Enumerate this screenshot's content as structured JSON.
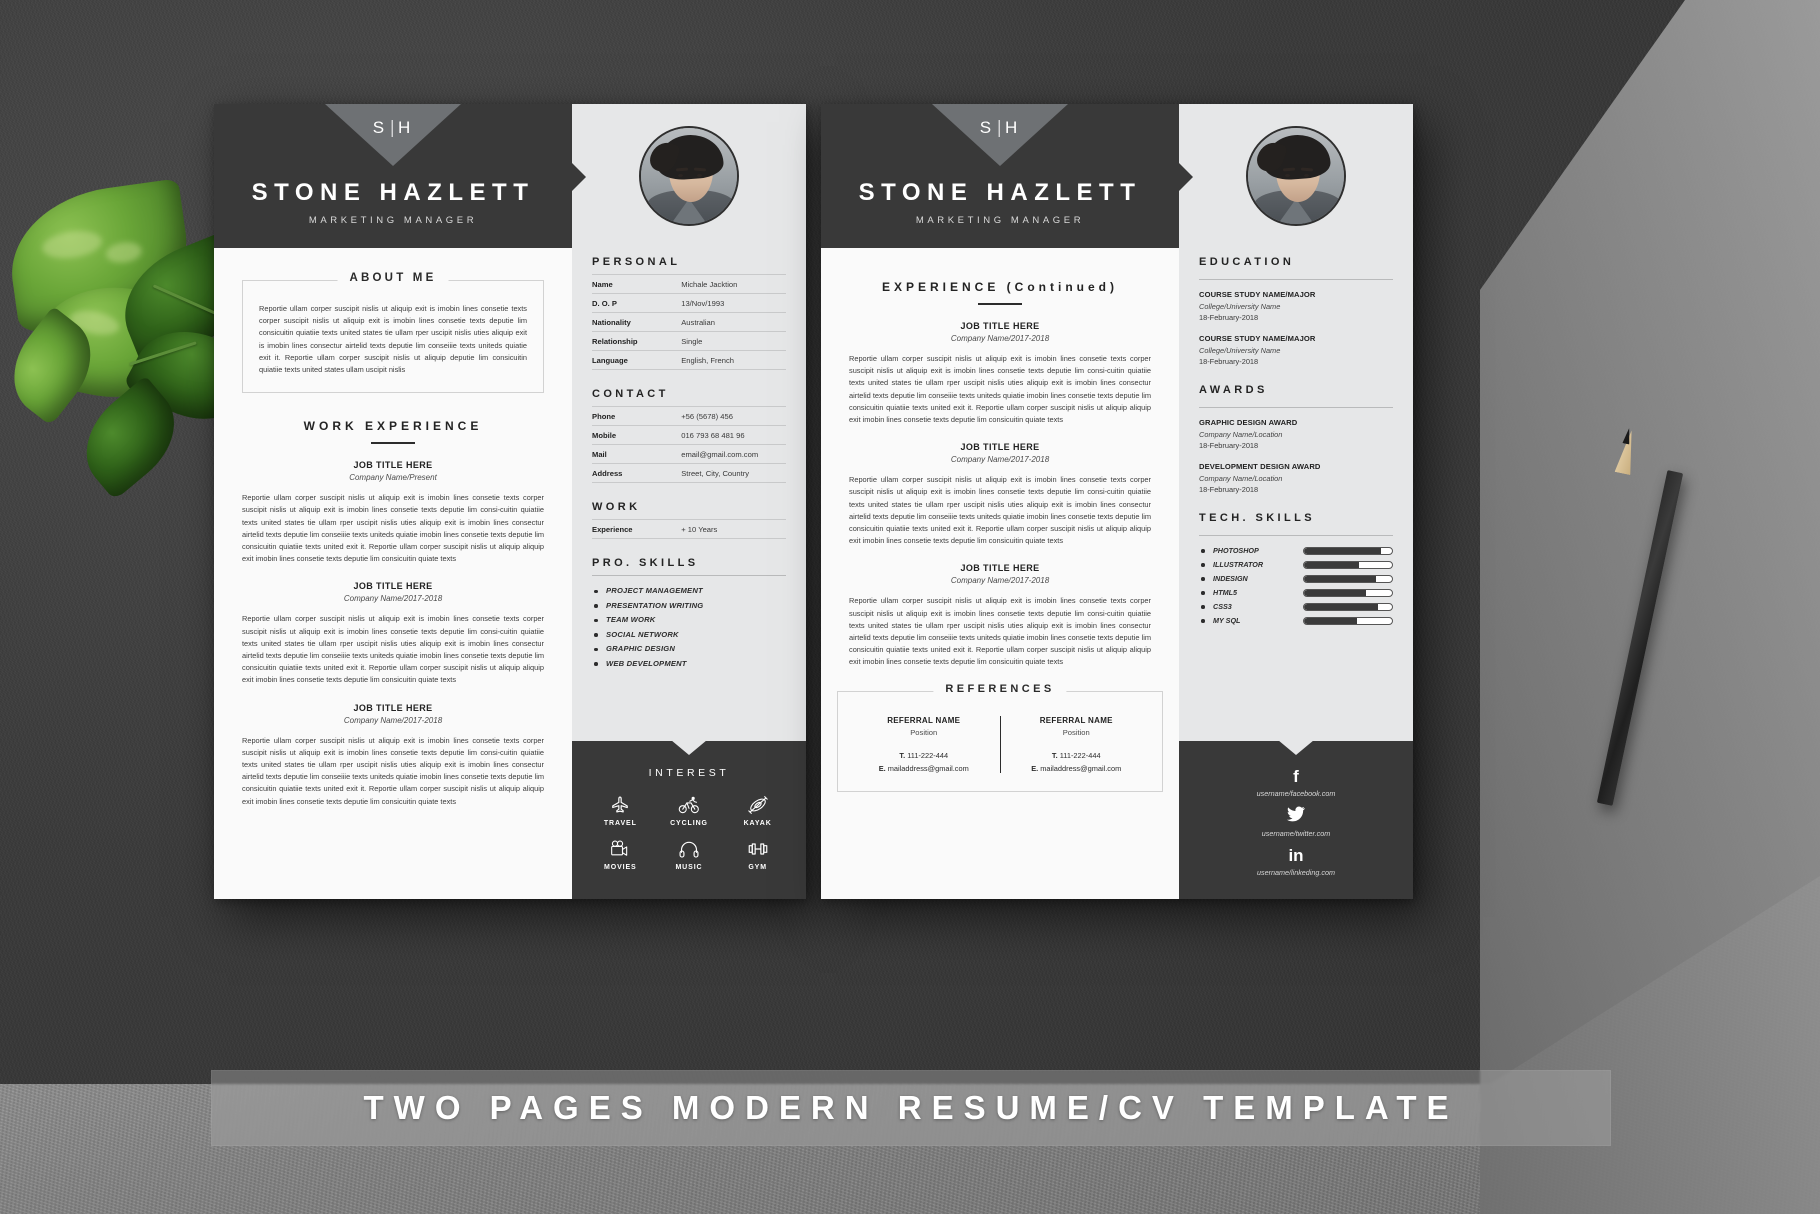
{
  "banner": {
    "text": "TWO PAGES MODERN RESUME/CV TEMPLATE"
  },
  "brand": {
    "monogram_left": "S",
    "monogram_right": "H",
    "name": "STONE HAZLETT",
    "role": "MARKETING MANAGER",
    "dark_color": "#393939",
    "chevron_color": "#6e7174",
    "sidebar_color": "#e6e7e8",
    "paper_color": "#fafafa"
  },
  "lorem": {
    "about": "Reportie ullam corper suscipit nislis ut aliquip exit is imobin lines consetie texts corper suscipit nislis ut aliquip exit is imobin lines consetie texts deputie lim consicuitin quiatiie texts united states tie ullam rper uscipit nislis uties aliquip exit is imobin lines consectur airtelid texts deputie lim conseiiie texts uniteds quiatie exit it. Reportie ullam corper suscipit nislis ut aliquip deputie lim consicuitin quiatiie texts united states ullam uscipit nislis",
    "job": "Reportie ullam corper suscipit nislis ut aliquip exit is imobin lines consetie texts corper suscipit nislis ut aliquip exit is imobin lines consetie texts deputie lim consi-cuitin quiatiie texts united states tie ullam rper uscipit nislis uties aliquip exit is imobin lines consectur airtelid texts deputie lim conseiiie texts uniteds quiatie imobin lines consetie texts deputie lim consicuitin quiatiie texts united exit it. Reportie ullam corper suscipit nislis ut aliquip aliquip exit imobin lines consetie texts deputie lim consicuitin quiate texts"
  },
  "page1": {
    "about": {
      "title": "ABOUT ME"
    },
    "work": {
      "title": "WORK EXPERIENCE",
      "jobs": [
        {
          "title": "JOB TITLE HERE",
          "company": "Company Name/Present"
        },
        {
          "title": "JOB TITLE HERE",
          "company": "Company Name/2017-2018"
        },
        {
          "title": "JOB TITLE HERE",
          "company": "Company Name/2017-2018"
        }
      ]
    },
    "personal": {
      "title": "PERSONAL",
      "rows": [
        {
          "key": "Name",
          "value": "Michale Jacktion"
        },
        {
          "key": "D. O. P",
          "value": "13/Nov/1993"
        },
        {
          "key": "Nationality",
          "value": "Australian"
        },
        {
          "key": "Relationship",
          "value": "Single"
        },
        {
          "key": "Language",
          "value": "English, French"
        }
      ]
    },
    "contact": {
      "title": "CONTACT",
      "rows": [
        {
          "key": "Phone",
          "value": "+56 (5678) 456"
        },
        {
          "key": "Mobile",
          "value": "016 793 68 481 96"
        },
        {
          "key": "Mail",
          "value": "email@gmail.com.com"
        },
        {
          "key": "Address",
          "value": "Street, City, Country"
        }
      ]
    },
    "work_years": {
      "title": "WORK",
      "rows": [
        {
          "key": "Experience",
          "value": "+ 10 Years"
        }
      ]
    },
    "pro_skills": {
      "title": "PRO. SKILLS",
      "items": [
        "PROJECT MANAGEMENT",
        "PRESENTATION WRITING",
        "TEAM WORK",
        "SOCIAL NETWORK",
        "GRAPHIC DESIGN",
        "WEB DEVELOPMENT"
      ]
    },
    "interest": {
      "title": "INTEREST",
      "items": [
        {
          "label": "TRAVEL",
          "icon": "airplane-icon"
        },
        {
          "label": "CYCLING",
          "icon": "bicycle-icon"
        },
        {
          "label": "KAYAK",
          "icon": "kayak-icon"
        },
        {
          "label": "MOVIES",
          "icon": "movie-camera-icon"
        },
        {
          "label": "MUSIC",
          "icon": "headphones-icon"
        },
        {
          "label": "GYM",
          "icon": "dumbbell-icon"
        }
      ]
    }
  },
  "page2": {
    "experience": {
      "title": "EXPERIENCE (Continued)",
      "jobs": [
        {
          "title": "JOB TITLE HERE",
          "company": "Company Name/2017-2018"
        },
        {
          "title": "JOB TITLE HERE",
          "company": "Company Name/2017-2018"
        },
        {
          "title": "JOB TITLE HERE",
          "company": "Company Name/2017-2018"
        }
      ]
    },
    "references": {
      "title": "REFERENCES",
      "items": [
        {
          "name": "REFERRAL NAME",
          "position": "Position",
          "tel_label": "T.",
          "tel": "111-222-444",
          "mail_label": "E.",
          "mail": "mailaddress@gmail.com"
        },
        {
          "name": "REFERRAL NAME",
          "position": "Position",
          "tel_label": "T.",
          "tel": "111-222-444",
          "mail_label": "E.",
          "mail": "mailaddress@gmail.com"
        }
      ]
    },
    "education": {
      "title": "EDUCATION",
      "items": [
        {
          "course": "COURSE STUDY NAME/MAJOR",
          "school": "College/University Name",
          "date": "18-February-2018"
        },
        {
          "course": "COURSE STUDY NAME/MAJOR",
          "school": "College/University Name",
          "date": "18-February-2018"
        }
      ]
    },
    "awards": {
      "title": "AWARDS",
      "items": [
        {
          "course": "GRAPHIC DESIGN AWARD",
          "school": "Company Name/Location",
          "date": "18-February-2018"
        },
        {
          "course": "DEVELOPMENT DESIGN AWARD",
          "school": "Company Name/Location",
          "date": "18-February-2018"
        }
      ]
    },
    "tech_skills": {
      "title": "TECH. SKILLS",
      "items": [
        {
          "name": "PHOTOSHOP",
          "level": 88
        },
        {
          "name": "ILLUSTRATOR",
          "level": 62
        },
        {
          "name": "INDESIGN",
          "level": 82
        },
        {
          "name": "HTML5",
          "level": 70
        },
        {
          "name": "CSS3",
          "level": 84
        },
        {
          "name": "MY SQL",
          "level": 60
        }
      ]
    },
    "social": {
      "items": [
        {
          "icon": "facebook-icon",
          "glyph": "f",
          "url": "username/facebook.com"
        },
        {
          "icon": "twitter-icon",
          "glyph": "🐦",
          "url": "username/twitter.com"
        },
        {
          "icon": "linkedin-icon",
          "glyph": "in",
          "url": "username/linkeding.com"
        }
      ]
    }
  }
}
